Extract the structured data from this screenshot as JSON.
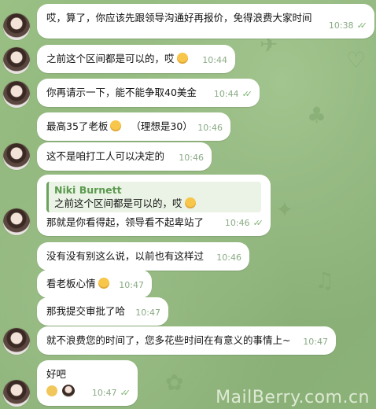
{
  "messages": [
    {
      "text": "哎，算了，你应该先跟领导沟通好再报价，免得浪费大家时间",
      "time": "10:38",
      "read": true
    },
    {
      "text": "之前这个区间都是可以的，哎",
      "time": "10:44",
      "emoji": true,
      "read": false
    },
    {
      "text": "你再请示一下，能不能争取40美金",
      "time": "10:44",
      "read": true
    },
    {
      "text": "最高35了老板",
      "suffix": "（理想是30）",
      "time": "10:46",
      "emoji": true,
      "read": false
    },
    {
      "text": "这不是咱打工人可以决定的",
      "time": "10:46",
      "read": false
    },
    {
      "reply_name": "Niki Burnett",
      "reply_text": "之前这个区间都是可以的，哎",
      "text": "那就是你看得起，领导看不起卑站了",
      "time": "10:46",
      "read": true
    },
    {
      "text": "没有没有别这么说，以前也有这样过",
      "time": "10:46",
      "read": false
    },
    {
      "text": "看老板心情",
      "time": "10:47",
      "emoji": true,
      "read": false
    },
    {
      "text": "那我提交审批了哈",
      "time": "10:47",
      "read": false
    },
    {
      "text": "就不浪费您的时间了，您多花些时间在有意义的事情上~",
      "time": "10:47",
      "read": false
    },
    {
      "text": "好吧",
      "time": "10:47",
      "read": true
    }
  ],
  "watermark": "MailBerry.com.cn",
  "colors": {
    "background": "#8fb57c",
    "bubble": "#ffffff",
    "accent": "#6aa35e"
  }
}
